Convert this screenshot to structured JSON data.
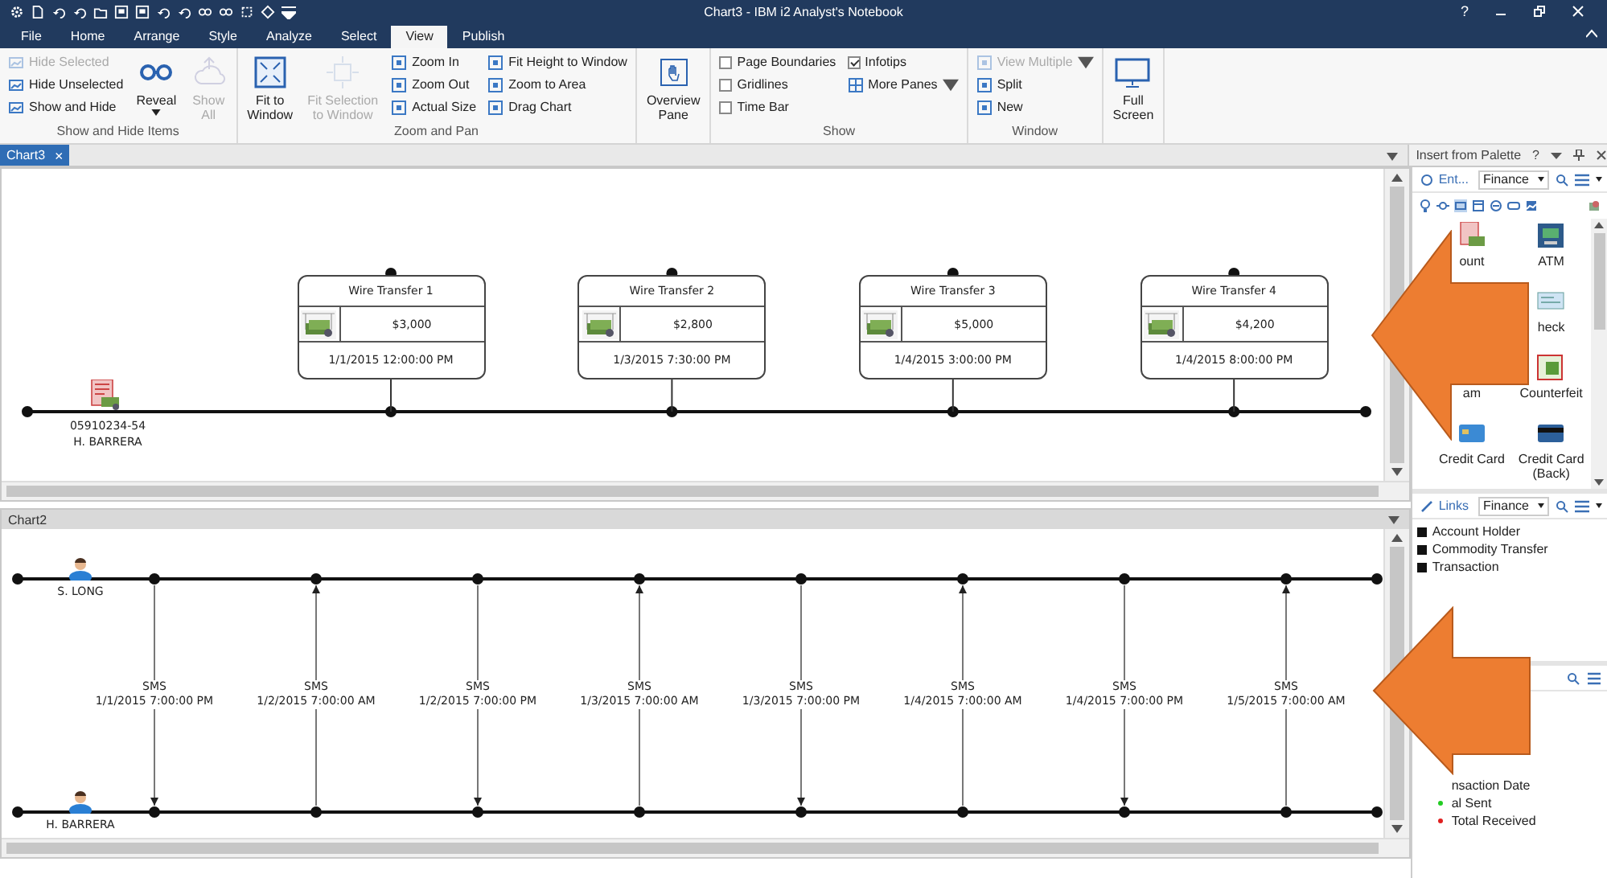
{
  "title_bar": {
    "title": "Chart3 - IBM i2 Analyst's Notebook",
    "help": "?"
  },
  "menu_tabs": [
    {
      "label": "File",
      "selected": false
    },
    {
      "label": "Home",
      "selected": false
    },
    {
      "label": "Arrange",
      "selected": false
    },
    {
      "label": "Style",
      "selected": false
    },
    {
      "label": "Analyze",
      "selected": false
    },
    {
      "label": "Select",
      "selected": false
    },
    {
      "label": "View",
      "selected": true
    },
    {
      "label": "Publish",
      "selected": false
    }
  ],
  "ribbon": {
    "groups": [
      {
        "label": "Show and Hide Items",
        "columns": [
          {
            "kind": "stack",
            "items": [
              {
                "kind": "small",
                "label": "Hide Selected",
                "disabled": true
              },
              {
                "kind": "small",
                "label": "Hide Unselected",
                "disabled": false
              },
              {
                "kind": "small",
                "label": "Show and Hide",
                "disabled": false
              }
            ]
          },
          {
            "kind": "large",
            "lines": [
              "Reveal"
            ],
            "disabled": false,
            "dropdown": true
          },
          {
            "kind": "large",
            "lines": [
              "Show",
              "All"
            ],
            "disabled": true,
            "dropdown": false
          }
        ]
      },
      {
        "label": "Zoom and Pan",
        "columns": [
          {
            "kind": "large",
            "lines": [
              "Fit to",
              "Window"
            ],
            "disabled": false,
            "dropdown": false
          },
          {
            "kind": "large",
            "lines": [
              "Fit Selection",
              "to Window"
            ],
            "disabled": true,
            "dropdown": false
          },
          {
            "kind": "stack",
            "items": [
              {
                "kind": "small",
                "label": "Zoom In",
                "disabled": false
              },
              {
                "kind": "small",
                "label": "Zoom Out",
                "disabled": false
              },
              {
                "kind": "small",
                "label": "Actual Size",
                "disabled": false
              }
            ]
          },
          {
            "kind": "stack",
            "items": [
              {
                "kind": "small",
                "label": "Fit Height to Window",
                "disabled": false
              },
              {
                "kind": "small",
                "label": "Zoom to Area",
                "disabled": false
              },
              {
                "kind": "small",
                "label": "Drag Chart",
                "disabled": false
              }
            ]
          }
        ]
      },
      {
        "columns": [
          {
            "kind": "large",
            "lines": [
              "Overview",
              "Pane"
            ],
            "disabled": false,
            "dropdown": false
          }
        ]
      },
      {
        "label": "Show",
        "columns": [
          {
            "kind": "stack",
            "items": [
              {
                "kind": "check",
                "label": "Page Boundaries",
                "checked": false
              },
              {
                "kind": "check",
                "label": "Gridlines",
                "checked": false
              },
              {
                "kind": "check",
                "label": "Time Bar",
                "checked": false
              }
            ]
          },
          {
            "kind": "stack",
            "items": [
              {
                "kind": "check",
                "label": "Infotips",
                "checked": true
              },
              {
                "kind": "small",
                "label": "More Panes",
                "disabled": false,
                "dropdown": true
              }
            ]
          }
        ]
      },
      {
        "label": "Window",
        "columns": [
          {
            "kind": "stack",
            "items": [
              {
                "kind": "small",
                "label": "View Multiple",
                "disabled": true,
                "dropdown": true
              },
              {
                "kind": "small",
                "label": "Split",
                "disabled": false
              },
              {
                "kind": "small",
                "label": "New",
                "disabled": false
              }
            ]
          }
        ]
      },
      {
        "columns": [
          {
            "kind": "large",
            "lines": [
              "Full",
              "Screen"
            ],
            "disabled": false,
            "dropdown": false
          }
        ]
      }
    ]
  },
  "doc_tabs": [
    {
      "label": "Chart3",
      "selected": true,
      "close": "×"
    }
  ],
  "chart1": {
    "entity": {
      "number": "05910234-54",
      "name": "H. BARRERA"
    },
    "events": [
      {
        "title": "Wire Transfer 1",
        "amount": "$3,000",
        "date": "1/1/2015 12:00:00 PM"
      },
      {
        "title": "Wire Transfer 2",
        "amount": "$2,800",
        "date": "1/3/2015 7:30:00 PM"
      },
      {
        "title": "Wire Transfer 3",
        "amount": "$5,000",
        "date": "1/4/2015 3:00:00 PM"
      },
      {
        "title": "Wire Transfer 4",
        "amount": "$4,200",
        "date": "1/4/2015 8:00:00 PM"
      }
    ]
  },
  "chart2": {
    "title": "Chart2",
    "top_person": "S. LONG",
    "bottom_person": "H. BARRERA",
    "links": [
      {
        "label": "SMS",
        "date": "1/1/2015 7:00:00 PM",
        "points_down": true
      },
      {
        "label": "SMS",
        "date": "1/2/2015 7:00:00 AM",
        "points_down": false
      },
      {
        "label": "SMS",
        "date": "1/2/2015 7:00:00 PM",
        "points_down": true
      },
      {
        "label": "SMS",
        "date": "1/3/2015 7:00:00 AM",
        "points_down": false
      },
      {
        "label": "SMS",
        "date": "1/3/2015 7:00:00 PM",
        "points_down": true
      },
      {
        "label": "SMS",
        "date": "1/4/2015 7:00:00 AM",
        "points_down": false
      },
      {
        "label": "SMS",
        "date": "1/4/2015 7:00:00 PM",
        "points_down": true
      },
      {
        "label": "SMS",
        "date": "1/5/2015 7:00:00 AM",
        "points_down": false
      }
    ]
  },
  "palette": {
    "title": "Insert from Palette",
    "help": "?",
    "entities": {
      "tab": "Ent...",
      "category": "Finance",
      "items": [
        {
          "kind": "item",
          "label": "ount"
        },
        {
          "kind": "item",
          "label": "ATM"
        },
        {
          "kind": "covered"
        },
        {
          "kind": "item",
          "label": "heck"
        },
        {
          "kind": "label_only",
          "label": "am"
        },
        {
          "kind": "item",
          "label": "Counterfeit"
        },
        {
          "kind": "item",
          "label": "Credit Card"
        },
        {
          "kind": "item",
          "label": "Credit Card (Back)"
        }
      ]
    },
    "links": {
      "tab": "Links",
      "category": "Finance",
      "items": [
        "Account Holder",
        "Commodity Transfer",
        "Transaction"
      ]
    },
    "attributes": {
      "items": [
        {
          "label": "nsaction Date"
        },
        {
          "label": "al Sent",
          "color": "#22cc22"
        },
        {
          "label": "Total Received",
          "color": "#e02020"
        }
      ]
    }
  },
  "overlays": [
    {
      "kind": "left_arrow"
    },
    {
      "kind": "left_arrow"
    }
  ]
}
